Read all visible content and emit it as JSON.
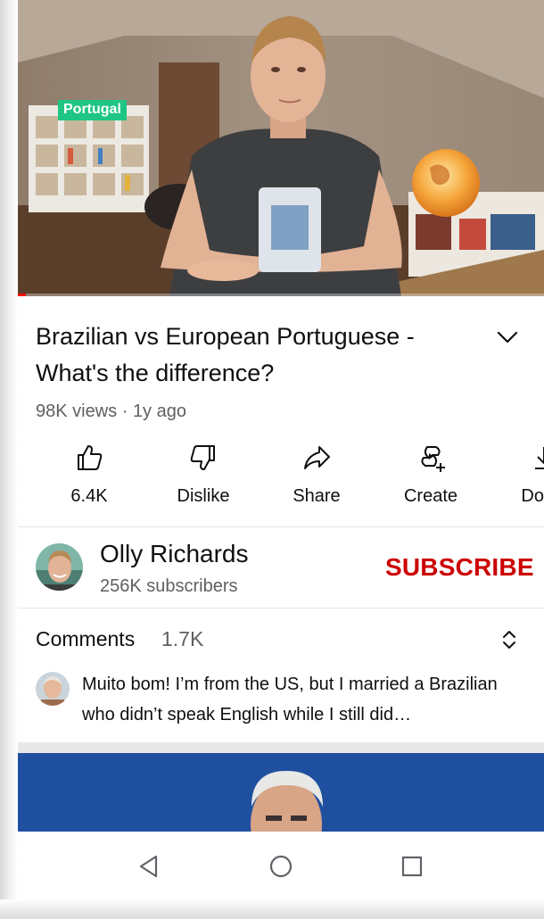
{
  "video": {
    "overlay_tag": "Portugal",
    "progress_fraction": 0.015,
    "title": "Brazilian vs European Portuguese - What's the difference?",
    "views": "98K views",
    "age": "1y ago"
  },
  "actions": [
    {
      "label": "6.4K",
      "icon": "thumbs-up-icon"
    },
    {
      "label": "Dislike",
      "icon": "thumbs-down-icon"
    },
    {
      "label": "Share",
      "icon": "share-icon"
    },
    {
      "label": "Create",
      "icon": "create-icon"
    },
    {
      "label": "Down",
      "icon": "download-icon"
    }
  ],
  "channel": {
    "name": "Olly Richards",
    "subscribers": "256K subscribers",
    "subscribe_label": "SUBSCRIBE"
  },
  "comments": {
    "title": "Comments",
    "count": "1.7K",
    "top_comment": "Muito bom! I’m from the US, but I married a Brazilian who didn’t speak English while I still did…"
  },
  "colors": {
    "subscribe": "#cc0000",
    "tag_bg": "#1ec583",
    "progress": "#ff0000",
    "meta_text": "#606060"
  },
  "navbar": {
    "icons": [
      "back-triangle-icon",
      "home-circle-icon",
      "recents-square-icon"
    ]
  }
}
